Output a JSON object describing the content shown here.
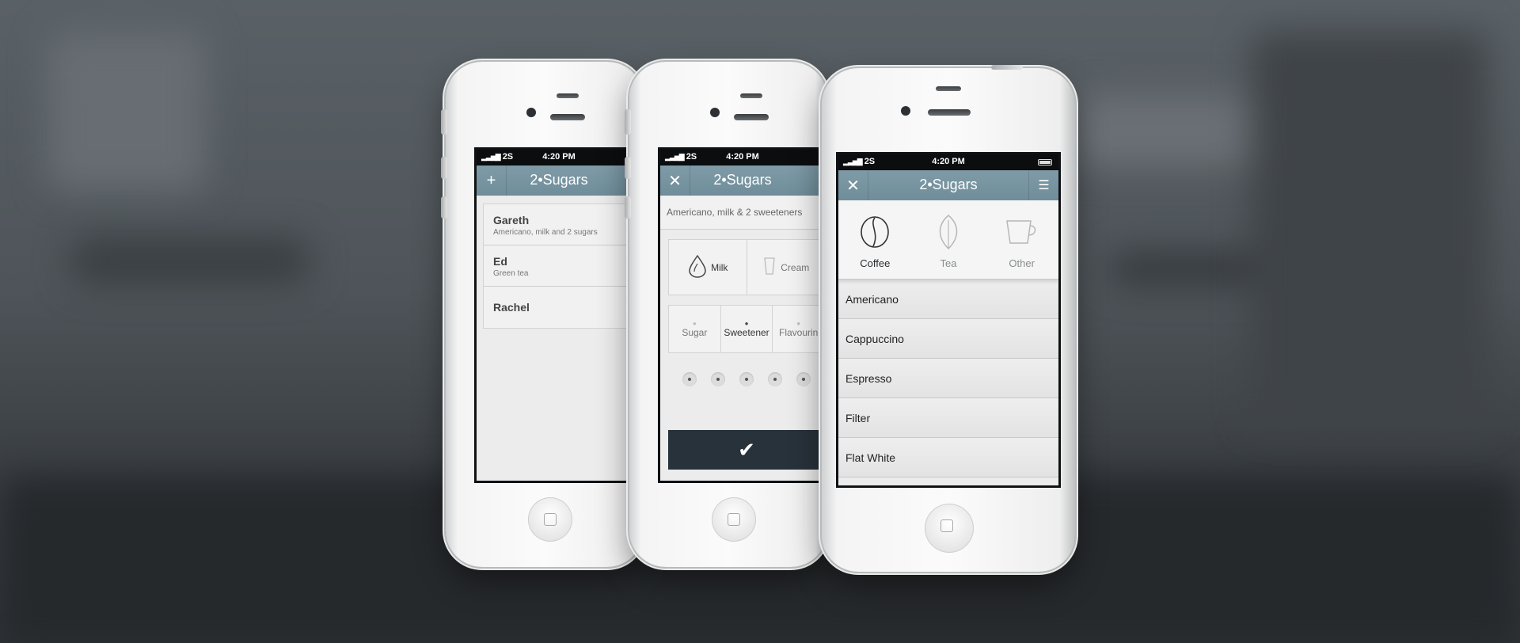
{
  "colors": {
    "navbar": "#7895a2",
    "confirm_button": "#28323b",
    "list_background": "#e8e8e8"
  },
  "statusbar": {
    "carrier": "2S",
    "time": "4:20 PM"
  },
  "app": {
    "title": "2•Sugars"
  },
  "phone_orders": {
    "nav_left_icon": "plus-icon",
    "people": [
      {
        "name": "Gareth",
        "order": "Americano, milk and 2 sugars"
      },
      {
        "name": "Ed",
        "order": "Green tea"
      },
      {
        "name": "Rachel",
        "order": ""
      }
    ]
  },
  "phone_options": {
    "nav_left_icon": "close-icon",
    "order_summary": "Americano, milk & 2 sweeteners",
    "additions": [
      {
        "label": "Milk",
        "icon": "milk-drop-icon",
        "selected": true
      },
      {
        "label": "Cream",
        "icon": "cream-icon",
        "selected": false
      }
    ],
    "sweeteners": [
      {
        "label": "Sugar",
        "selected": false
      },
      {
        "label": "Sweetener",
        "selected": true
      },
      {
        "label": "Flavourin",
        "selected": false
      }
    ],
    "quantity_dots": 5,
    "confirm_icon": "checkmark-icon"
  },
  "phone_menu": {
    "nav_left_icon": "close-icon",
    "nav_right_icon": "menu-icon",
    "categories": [
      {
        "label": "Coffee",
        "icon": "coffee-bean-icon",
        "active": true
      },
      {
        "label": "Tea",
        "icon": "tea-leaf-icon",
        "active": false
      },
      {
        "label": "Other",
        "icon": "cup-icon",
        "active": false
      }
    ],
    "drinks": [
      "Americano",
      "Cappuccino",
      "Espresso",
      "Filter",
      "Flat White"
    ]
  }
}
